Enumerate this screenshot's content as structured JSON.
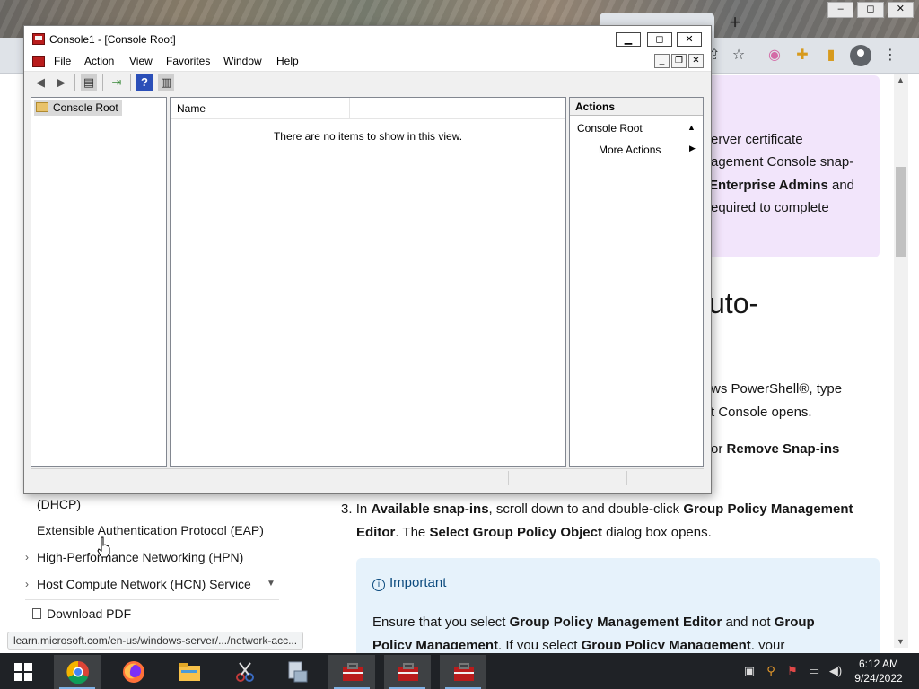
{
  "browser": {
    "new_tab_label": "+",
    "window_controls": [
      "–",
      "◻",
      "✕"
    ],
    "status_url": "learn.microsoft.com/en-us/windows-server/.../network-acc..."
  },
  "left_nav": {
    "item_dhcp": "(DHCP)",
    "item_eap": "Extensible Authentication Protocol (EAP)",
    "item_hpn": "High-Performance Networking (HPN)",
    "item_hcn": "Host Compute Network (HCN) Service",
    "download_pdf": "Download PDF"
  },
  "article": {
    "note_line1": "erver certificate",
    "note_line2": "agement Console snap-",
    "note_line3_bold": "Enterprise Admins",
    "note_line3_rest": " and",
    "note_line4": "equired to complete",
    "heading_fragment": "uto-",
    "para1_line1": "ws PowerShell®, type",
    "para1_line2": "t Console opens.",
    "para2_prefix": "or ",
    "para2_bold": "Remove Snap-ins",
    "step3_number": "3.",
    "step3_t1": "In ",
    "step3_b1": "Available snap-ins",
    "step3_t2": ", scroll down to and double-click ",
    "step3_b2": "Group Policy Management",
    "step3_b3": "Editor",
    "step3_t3": ". The ",
    "step3_b4": "Select Group Policy Object",
    "step3_t4": " dialog box opens.",
    "important_title": "Important",
    "important_t1": "Ensure that you select ",
    "important_b1": "Group Policy Management Editor",
    "important_t2": " and not ",
    "important_b2": "Group",
    "important_b3": "Policy Management",
    "important_t3": ". If you select ",
    "important_b4": "Group Policy Management",
    "important_t4": ", your"
  },
  "mmc": {
    "title": "Console1 - [Console Root]",
    "caption_buttons": {
      "minimize": "▁",
      "maximize": "◻",
      "close": "✕"
    },
    "menu": [
      "File",
      "Action",
      "View",
      "Favorites",
      "Window",
      "Help"
    ],
    "mdi_buttons": {
      "minimize": "_",
      "restore": "❐",
      "close": "✕"
    },
    "tree_root": "Console Root",
    "list_column_name": "Name",
    "empty_message": "There are no items to show in this view.",
    "actions_header": "Actions",
    "actions_section": "Console Root",
    "actions_more": "More Actions"
  },
  "taskbar": {
    "time": "6:12 AM",
    "date": "9/24/2022",
    "apps": [
      "chrome",
      "firefox",
      "file-explorer",
      "snipping-tool",
      "network",
      "toolbox-1",
      "toolbox-2",
      "toolbox-3"
    ]
  },
  "colors": {
    "mmc_icon_red": "#b91c1c",
    "note_purple": "#f2e5fb",
    "important_blue": "#e6f2fb",
    "taskbar": "#1f2226"
  }
}
